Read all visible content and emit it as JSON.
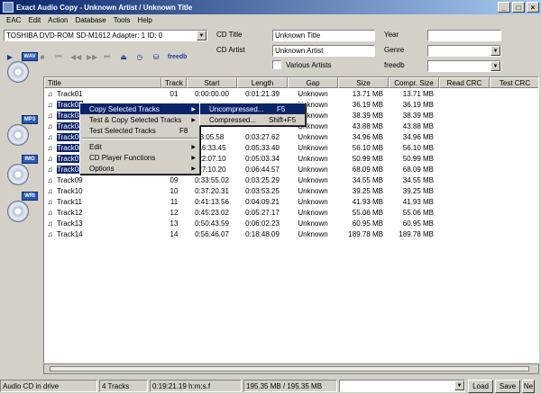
{
  "window": {
    "title": "Exact Audio Copy   -   Unknown Artist / Unknown Title",
    "min_glyph": "_",
    "max_glyph": "□",
    "close_glyph": "×"
  },
  "menubar": [
    "EAC",
    "Edit",
    "Action",
    "Database",
    "Tools",
    "Help"
  ],
  "drive": {
    "selected": "TOSHIBA DVD-ROM SD-M1612  Adapter: 1  ID: 0"
  },
  "transport": {
    "play": "▶",
    "pause": "❚❚",
    "stop": "■",
    "prev": "⏮",
    "rew": "◀◀",
    "fwd": "▶▶",
    "next": "⏭",
    "eject": "⏏",
    "clock": "◷",
    "db": "⛁",
    "freedb": "freedb"
  },
  "cd": {
    "title_label": "CD Title",
    "title_value": "Unknown Title",
    "artist_label": "CD Artist",
    "artist_value": "Unknown Artist",
    "various_label": "Various Artists",
    "year_label": "Year",
    "genre_label": "Genre",
    "freedb_label": "freedb"
  },
  "side_icons": [
    "WAV",
    "MP3",
    "IMG",
    "WRI"
  ],
  "columns": [
    "Title",
    "Track",
    "Start",
    "Length",
    "Gap",
    "Size",
    "Compr. Size",
    "Read CRC",
    "Test CRC"
  ],
  "tracks": [
    {
      "title": "Track01",
      "track": "01",
      "start": "0:00:00.00",
      "length": "0:01:21.39",
      "gap": "Unknown",
      "size": "13.71 MB",
      "csize": "13.71 MB",
      "selected": false
    },
    {
      "title": "Track02",
      "track": "",
      "start": "",
      "length": "",
      "gap": "Unknown",
      "size": "36.19 MB",
      "csize": "36.19 MB",
      "selected": true
    },
    {
      "title": "Track03",
      "track": "",
      "start": "",
      "length": "",
      "gap": "Unknown",
      "size": "38.39 MB",
      "csize": "38.39 MB",
      "selected": true
    },
    {
      "title": "Track04",
      "track": "",
      "start": "",
      "length": "",
      "gap": "Unknown",
      "size": "43.88 MB",
      "csize": "43.88 MB",
      "selected": true
    },
    {
      "title": "Track05",
      "track": "",
      "start": "3:05.58",
      "length": "0:03:27.62",
      "gap": "Unknown",
      "size": "34.96 MB",
      "csize": "34.96 MB",
      "selected": true
    },
    {
      "title": "Track06",
      "track": "",
      "start": "16:33.45",
      "length": "0:05:33.40",
      "gap": "Unknown",
      "size": "56.10 MB",
      "csize": "56.10 MB",
      "selected": true
    },
    {
      "title": "Track07",
      "track": "",
      "start": "22:07.10",
      "length": "0:05:03.34",
      "gap": "Unknown",
      "size": "50.99 MB",
      "csize": "50.99 MB",
      "selected": true
    },
    {
      "title": "Track08",
      "track": "",
      "start": "27:10.20",
      "length": "0:06:44.57",
      "gap": "Unknown",
      "size": "68.09 MB",
      "csize": "68.09 MB",
      "selected": true
    },
    {
      "title": "Track09",
      "track": "09",
      "start": "0:33:55.02",
      "length": "0:03:25.29",
      "gap": "Unknown",
      "size": "34.55 MB",
      "csize": "34.55 MB",
      "selected": false
    },
    {
      "title": "Track10",
      "track": "10",
      "start": "0:37:20.31",
      "length": "0:03:53.25",
      "gap": "Unknown",
      "size": "39.25 MB",
      "csize": "39.25 MB",
      "selected": false
    },
    {
      "title": "Track11",
      "track": "11",
      "start": "0:41:13.56",
      "length": "0:04:09.21",
      "gap": "Unknown",
      "size": "41.93 MB",
      "csize": "41.93 MB",
      "selected": false
    },
    {
      "title": "Track12",
      "track": "12",
      "start": "0:45:23.02",
      "length": "0:05:27.17",
      "gap": "Unknown",
      "size": "55.06 MB",
      "csize": "55.06 MB",
      "selected": false
    },
    {
      "title": "Track13",
      "track": "13",
      "start": "0:50:43.59",
      "length": "0:06:02.23",
      "gap": "Unknown",
      "size": "60.95 MB",
      "csize": "60.95 MB",
      "selected": false
    },
    {
      "title": "Track14",
      "track": "14",
      "start": "0:56:46.07",
      "length": "0:18:48.09",
      "gap": "Unknown",
      "size": "189.78 MB",
      "csize": "189.78 MB",
      "selected": false
    }
  ],
  "context_menu": {
    "copy_selected": "Copy Selected Tracks",
    "test_copy_selected": "Test & Copy Selected Tracks",
    "test_selected": "Test Selected Tracks",
    "test_selected_shortcut": "F8",
    "edit": "Edit",
    "cd_player": "CD Player Functions",
    "options": "Options",
    "arrow": "▶"
  },
  "submenu": {
    "uncompressed": "Uncompressed...",
    "uncompressed_shortcut": "F5",
    "compressed": "Compressed...",
    "compressed_shortcut": "Shift+F5"
  },
  "status": {
    "disc": "Audio CD in drive",
    "tracks": "4 Tracks",
    "time": "0:19:21.19 h:m:s.f",
    "size": "195.35 MB / 195.35 MB",
    "load": "Load",
    "save": "Save",
    "new": "Ne"
  }
}
